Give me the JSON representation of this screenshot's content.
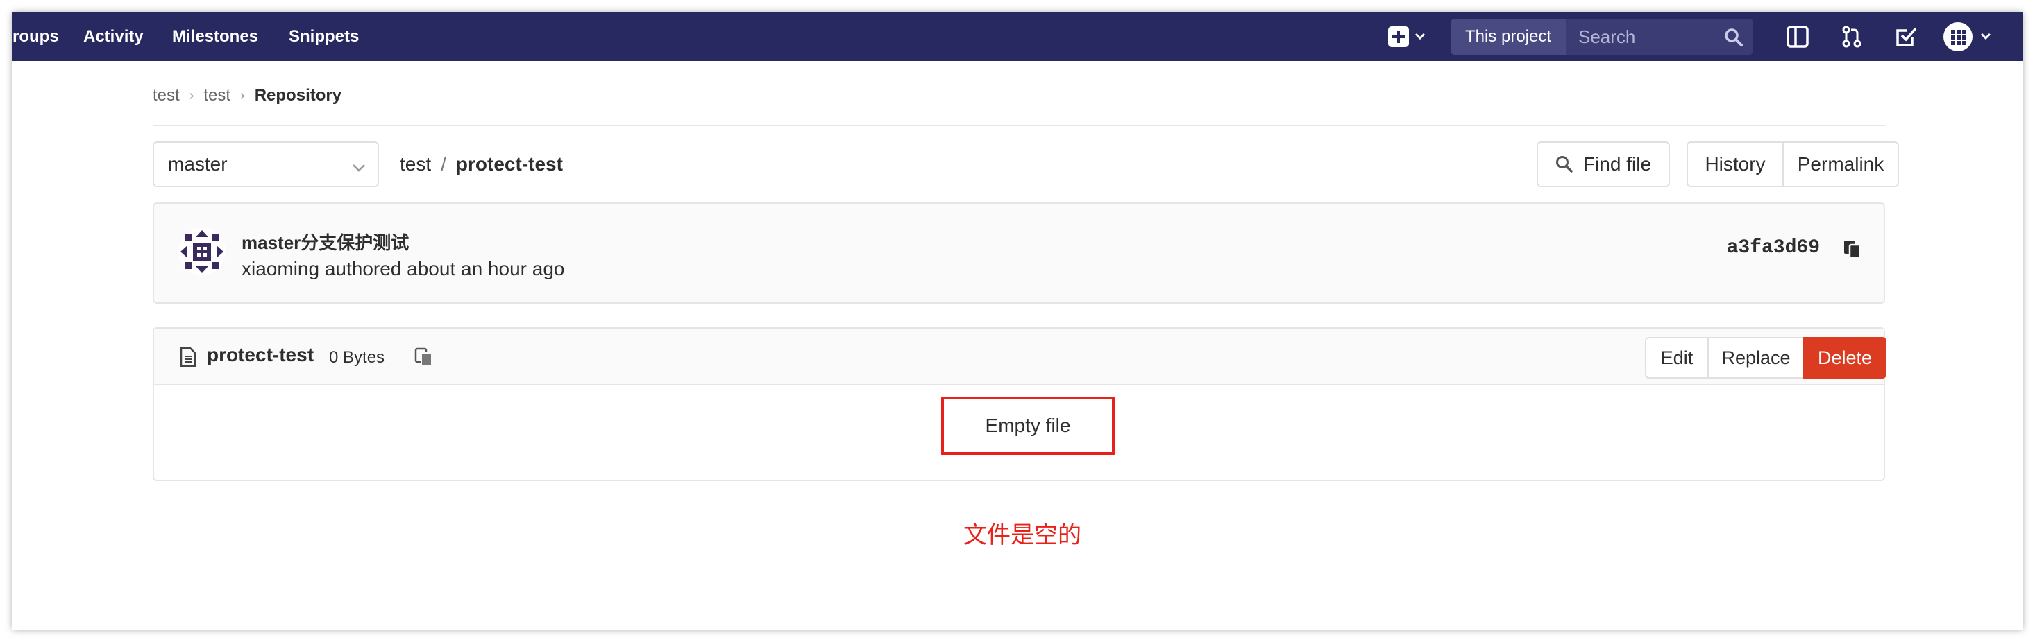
{
  "nav": {
    "links": [
      "roups",
      "Activity",
      "Milestones",
      "Snippets"
    ],
    "search_scope": "This project",
    "search_placeholder": "Search"
  },
  "breadcrumb": {
    "items": [
      "test",
      "test"
    ],
    "current": "Repository"
  },
  "repo": {
    "branch": "master",
    "path_namespace": "test",
    "path_separator": "/",
    "path_file": "protect-test",
    "find_file_label": "Find file",
    "history_label": "History",
    "permalink_label": "Permalink"
  },
  "commit": {
    "title": "master分支保护测试",
    "author_line": "xiaoming authored about an hour ago",
    "sha": "a3fa3d69"
  },
  "file": {
    "name": "protect-test",
    "size": "0 Bytes",
    "edit_label": "Edit",
    "replace_label": "Replace",
    "delete_label": "Delete",
    "empty_text": "Empty file"
  },
  "annotation": "文件是空的",
  "colors": {
    "navbar": "#292961",
    "danger": "#db3b21",
    "annotation": "#e8221a"
  }
}
